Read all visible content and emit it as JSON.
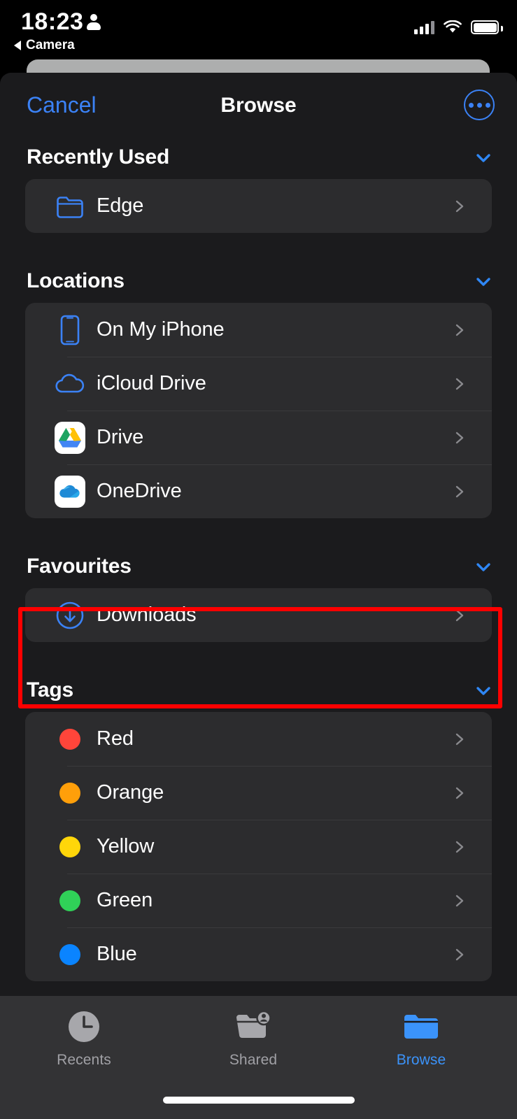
{
  "status_bar": {
    "time": "18:23",
    "person_icon": "person-icon",
    "back_app_label": "Camera",
    "back_icon": "back-triangle-icon",
    "cellular_icon": "cellular-signal-icon",
    "cellular_bars_on": 3,
    "wifi_icon": "wifi-icon",
    "battery_icon": "battery-full-icon"
  },
  "nav": {
    "cancel_label": "Cancel",
    "title": "Browse",
    "more_icon": "ellipsis-circle-icon"
  },
  "sections": [
    {
      "title": "Recently Used",
      "collapse_icon": "chevron-down-icon",
      "rows": [
        {
          "label": "Edge",
          "icon": "folder-outline-icon",
          "chevron": "chevron-right-icon"
        }
      ]
    },
    {
      "title": "Locations",
      "collapse_icon": "chevron-down-icon",
      "rows": [
        {
          "label": "On My iPhone",
          "icon": "iphone-icon",
          "chevron": "chevron-right-icon"
        },
        {
          "label": "iCloud Drive",
          "icon": "icloud-icon",
          "chevron": "chevron-right-icon"
        },
        {
          "label": "Drive",
          "icon": "google-drive-icon",
          "chevron": "chevron-right-icon"
        },
        {
          "label": "OneDrive",
          "icon": "onedrive-icon",
          "chevron": "chevron-right-icon"
        }
      ]
    },
    {
      "title": "Favourites",
      "collapse_icon": "chevron-down-icon",
      "rows": [
        {
          "label": "Downloads",
          "icon": "download-circle-icon",
          "chevron": "chevron-right-icon"
        }
      ]
    },
    {
      "title": "Tags",
      "collapse_icon": "chevron-down-icon",
      "rows": [
        {
          "label": "Red",
          "icon": "tag-dot-icon",
          "color": "#ff453a",
          "chevron": "chevron-right-icon"
        },
        {
          "label": "Orange",
          "icon": "tag-dot-icon",
          "color": "#ff9f0a",
          "chevron": "chevron-right-icon"
        },
        {
          "label": "Yellow",
          "icon": "tag-dot-icon",
          "color": "#ffd60a",
          "chevron": "chevron-right-icon"
        },
        {
          "label": "Green",
          "icon": "tag-dot-icon",
          "color": "#30d158",
          "chevron": "chevron-right-icon"
        },
        {
          "label": "Blue",
          "icon": "tag-dot-icon",
          "color": "#0a84ff",
          "chevron": "chevron-right-icon"
        }
      ]
    }
  ],
  "highlight": {
    "target": "Downloads",
    "color": "#ff0000"
  },
  "tab_bar": {
    "tabs": [
      {
        "label": "Recents",
        "icon": "clock-icon",
        "active": false
      },
      {
        "label": "Shared",
        "icon": "folder-person-icon",
        "active": false
      },
      {
        "label": "Browse",
        "icon": "folder-filled-icon",
        "active": true
      }
    ],
    "active_color": "#0a84ff",
    "inactive_color": "#a0a0a5"
  },
  "colors": {
    "sheet_background": "#1b1b1d",
    "card_background": "#2c2c2e",
    "accent_blue": "#3b82f6",
    "separator": "#3a3a3c"
  }
}
